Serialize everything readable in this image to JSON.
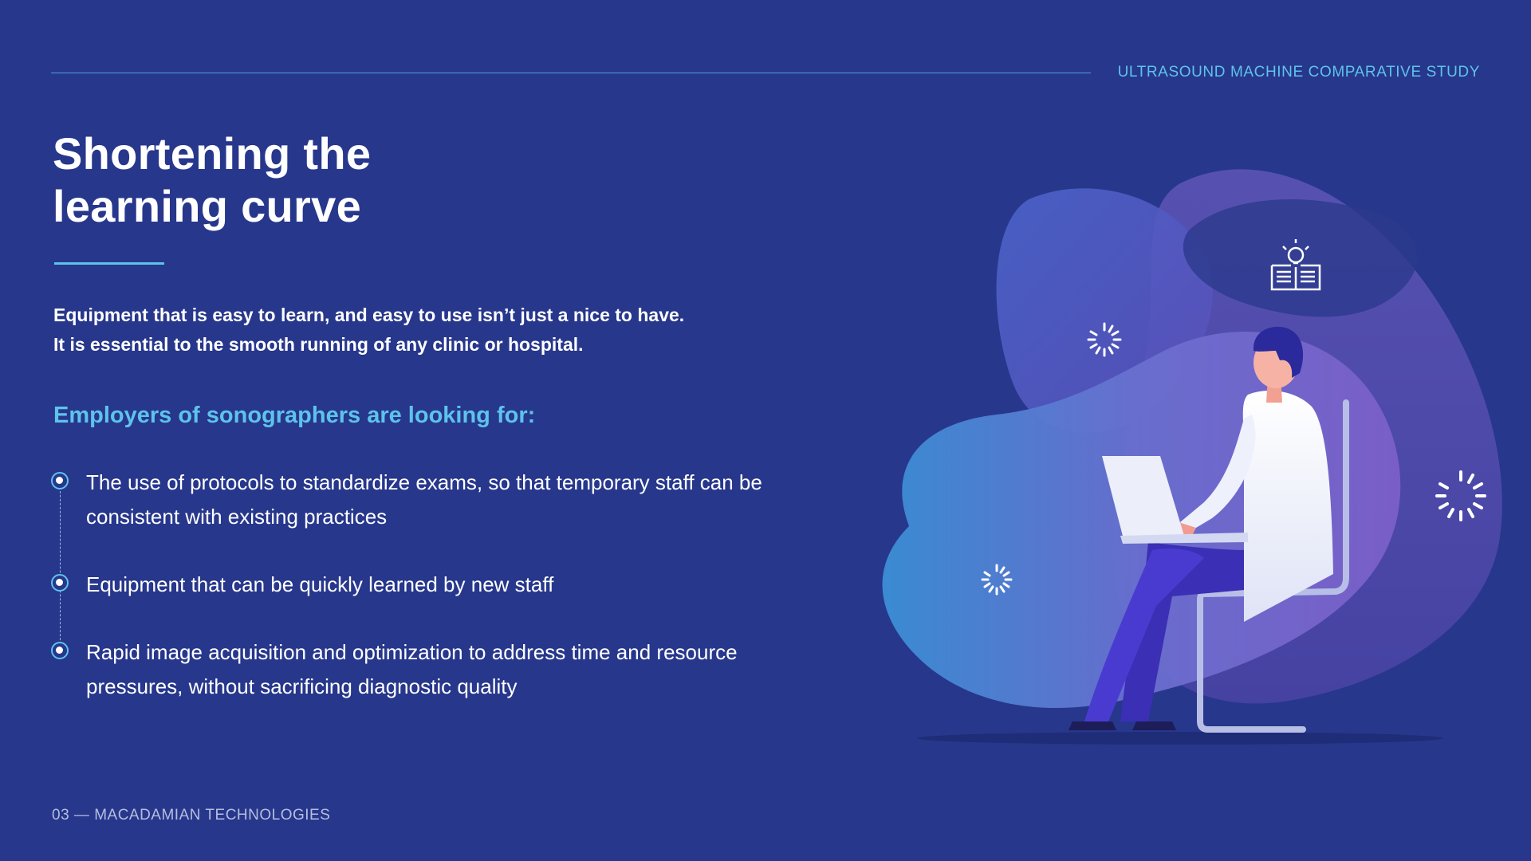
{
  "header": {
    "study_title": "ULTRASOUND MACHINE COMPARATIVE STUDY"
  },
  "main": {
    "title_line1": "Shortening the",
    "title_line2": "learning curve",
    "intro_line1": "Equipment that is easy to learn, and easy to use isn’t just a nice to have.",
    "intro_line2": "It is essential to the smooth running of any clinic or hospital.",
    "subheading": "Employers of sonographers are looking for:",
    "bullets": [
      {
        "text": "The use of protocols to standardize exams, so that temporary staff can be consistent with existing practices"
      },
      {
        "text": "Equipment that can be quickly learned by new staff"
      },
      {
        "text": "Rapid image acquisition and optimization to address time and resource pressures, without sacrificing diagnostic quality"
      }
    ]
  },
  "footer": {
    "page_label": "03 — MACADAMIAN TECHNOLOGIES"
  },
  "illustration": {
    "icons": [
      "loading-spinner-icon",
      "lightbulb-book-icon"
    ]
  },
  "colors": {
    "background": "#27378c",
    "accent": "#5ec3ea",
    "text": "#ffffff",
    "footer_text": "#b5bddf"
  }
}
